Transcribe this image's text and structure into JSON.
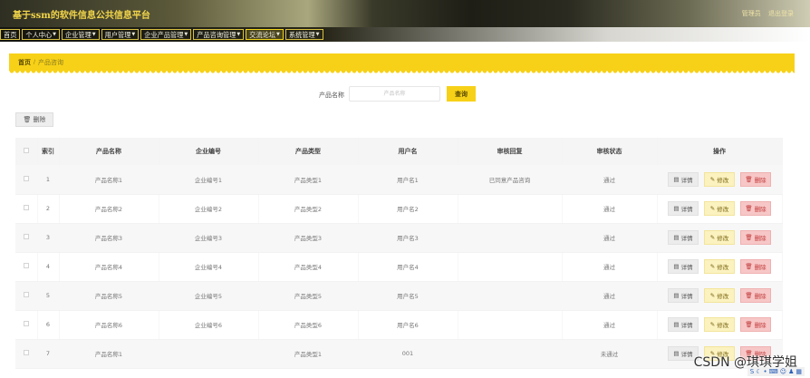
{
  "header": {
    "title": "基于ssm的软件信息公共信息平台",
    "user_label": "管理员",
    "logout": "退出登录"
  },
  "nav": [
    {
      "label": "首页",
      "has_caret": false
    },
    {
      "label": "个人中心",
      "has_caret": true
    },
    {
      "label": "企业管理",
      "has_caret": true
    },
    {
      "label": "用户管理",
      "has_caret": true
    },
    {
      "label": "企业产品管理",
      "has_caret": true
    },
    {
      "label": "产品咨询管理",
      "has_caret": true
    },
    {
      "label": "交流论坛",
      "has_caret": true
    },
    {
      "label": "系统管理",
      "has_caret": true
    }
  ],
  "breadcrumb": {
    "home": "首页",
    "separator": "/",
    "current": "产品咨询"
  },
  "search": {
    "label": "产品名称",
    "placeholder": "产品名称",
    "button": "查询"
  },
  "batch_delete": {
    "icon": "trash-icon",
    "label": "删除"
  },
  "table": {
    "headers": [
      "",
      "索引",
      "产品名称",
      "企业编号",
      "产品类型",
      "用户名",
      "审核回复",
      "审核状态",
      "操作"
    ],
    "rows": [
      {
        "index": "1",
        "product": "产品名称1",
        "company": "企业编号1",
        "type": "产品类型1",
        "user": "用户名1",
        "reply": "已同意产品咨询",
        "status": "通过"
      },
      {
        "index": "2",
        "product": "产品名称2",
        "company": "企业编号2",
        "type": "产品类型2",
        "user": "用户名2",
        "reply": "",
        "status": "通过"
      },
      {
        "index": "3",
        "product": "产品名称3",
        "company": "企业编号3",
        "type": "产品类型3",
        "user": "用户名3",
        "reply": "",
        "status": "通过"
      },
      {
        "index": "4",
        "product": "产品名称4",
        "company": "企业编号4",
        "type": "产品类型4",
        "user": "用户名4",
        "reply": "",
        "status": "通过"
      },
      {
        "index": "5",
        "product": "产品名称5",
        "company": "企业编号5",
        "type": "产品类型5",
        "user": "用户名5",
        "reply": "",
        "status": "通过"
      },
      {
        "index": "6",
        "product": "产品名称6",
        "company": "企业编号6",
        "type": "产品类型6",
        "user": "用户名6",
        "reply": "",
        "status": "通过"
      },
      {
        "index": "7",
        "product": "产品名称1",
        "company": "",
        "type": "产品类型1",
        "user": "001",
        "reply": "",
        "status": "未通过"
      }
    ],
    "actions": {
      "detail": "详情",
      "edit": "修改",
      "delete": "删除"
    }
  },
  "watermark": "CSDN @琪琪学姐",
  "colors": {
    "accent": "#f7d117",
    "header_title": "#f3d64a",
    "edit_button": "#fbf2c0",
    "delete_button": "#f7c7c7"
  }
}
